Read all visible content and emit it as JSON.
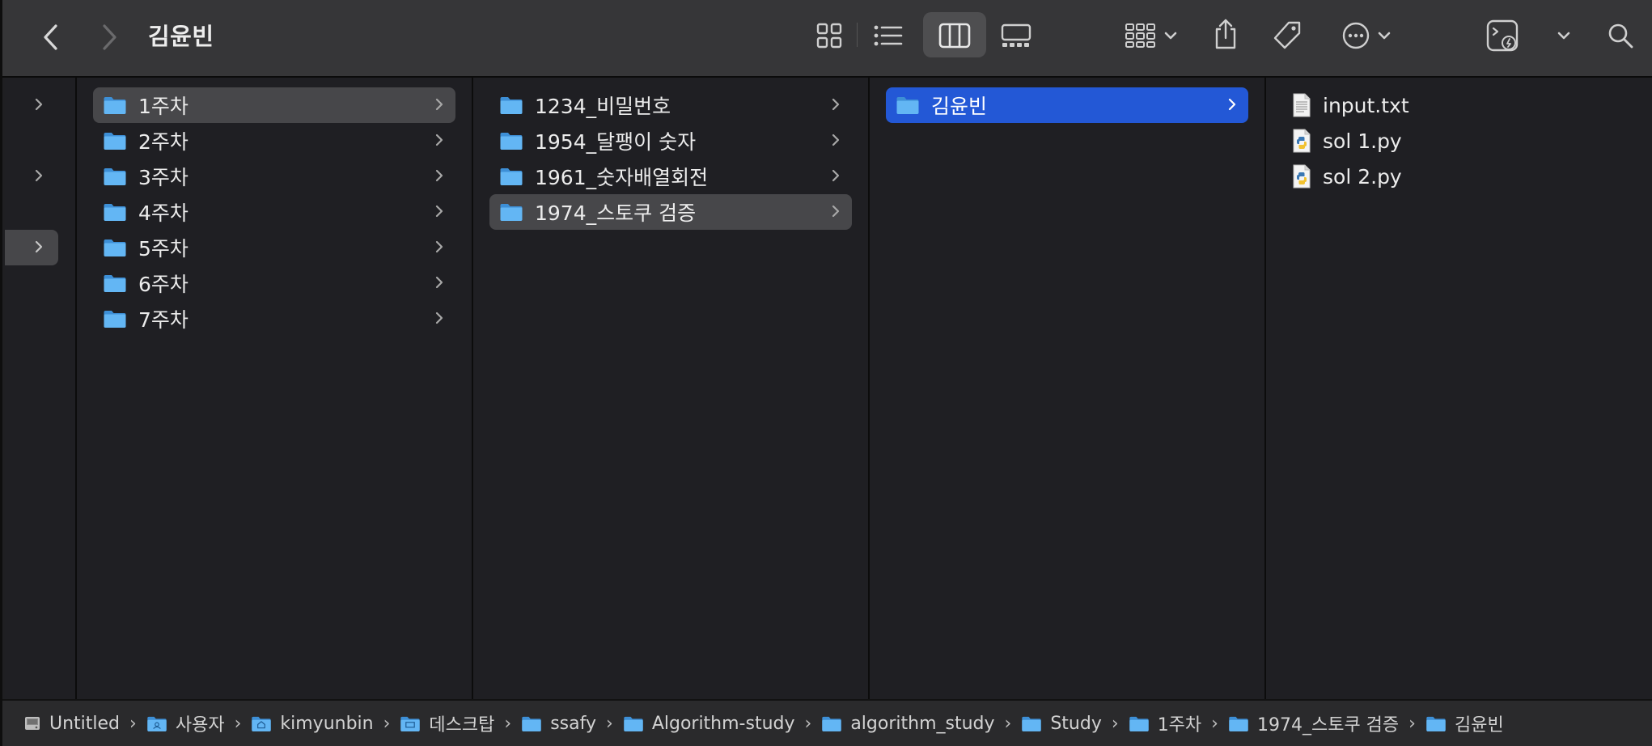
{
  "window": {
    "title": "김윤빈"
  },
  "toolbar": {
    "back": "chevron-left-icon",
    "forward": "chevron-right-icon",
    "views": [
      "grid-view-icon",
      "list-view-icon",
      "column-view-icon",
      "gallery-view-icon"
    ],
    "active_view": "column-view-icon",
    "actions": [
      "group-icon",
      "share-icon",
      "tag-icon",
      "more-icon",
      "terminal-icon",
      "search-icon"
    ]
  },
  "columns": {
    "sidebar": {
      "rows": [
        ">",
        ">",
        ">"
      ]
    },
    "col1": {
      "items": [
        {
          "label": "1주차",
          "selected": true
        },
        {
          "label": "2주차"
        },
        {
          "label": "3주차"
        },
        {
          "label": "4주차"
        },
        {
          "label": "5주차"
        },
        {
          "label": "6주차"
        },
        {
          "label": "7주차"
        }
      ]
    },
    "col2": {
      "items": [
        {
          "label": "1234_비밀번호"
        },
        {
          "label": "1954_달팽이 숫자"
        },
        {
          "label": "1961_숫자배열회전"
        },
        {
          "label": "1974_스토쿠 검증",
          "selected": true
        }
      ]
    },
    "col3": {
      "items": [
        {
          "label": "김윤빈",
          "selected": true
        }
      ]
    },
    "col4": {
      "items": [
        {
          "label": "input.txt",
          "icon": "text-file-icon"
        },
        {
          "label": "sol 1.py",
          "icon": "python-file-icon"
        },
        {
          "label": "sol 2.py",
          "icon": "python-file-icon"
        }
      ]
    }
  },
  "pathbar": {
    "crumbs": [
      {
        "label": "Untitled",
        "icon": "disk-icon"
      },
      {
        "label": "사용자",
        "icon": "users-folder-icon"
      },
      {
        "label": "kimyunbin",
        "icon": "home-folder-icon"
      },
      {
        "label": "데스크탑",
        "icon": "desktop-folder-icon"
      },
      {
        "label": "ssafy",
        "icon": "folder-icon"
      },
      {
        "label": "Algorithm-study",
        "icon": "folder-icon"
      },
      {
        "label": "algorithm_study",
        "icon": "folder-icon"
      },
      {
        "label": "Study",
        "icon": "folder-icon"
      },
      {
        "label": "1주차",
        "icon": "folder-icon"
      },
      {
        "label": "1974_스토쿠 검증",
        "icon": "folder-icon"
      },
      {
        "label": "김윤빈",
        "icon": "folder-icon"
      }
    ],
    "separator": "›"
  },
  "colors": {
    "toolbar_bg": "#363638",
    "content_bg": "#1f1f23",
    "selection_blue": "#2358d6",
    "selection_gray": "#47474a",
    "folder_blue": "#5aaef2"
  }
}
